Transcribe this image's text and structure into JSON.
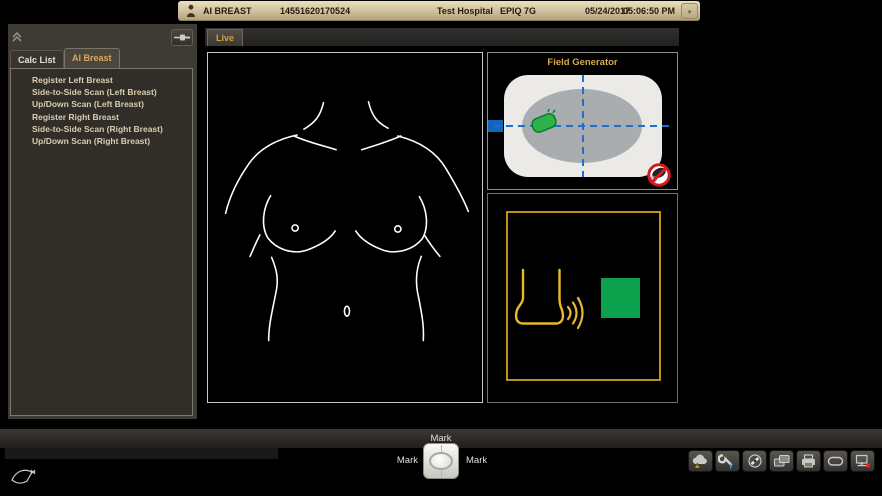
{
  "header": {
    "app_title": "AI BREAST",
    "exam_id": "14551620170524",
    "hospital": "Test Hospital",
    "system": "EPIQ 7G",
    "date": "05/24/2017",
    "time": "05:06:50 PM",
    "dropdown_glyph": "▼"
  },
  "sidebar": {
    "tabs": [
      {
        "label": "Calc List",
        "active": false
      },
      {
        "label": "AI Breast",
        "active": true
      }
    ],
    "items": [
      {
        "label": "Register Left Breast"
      },
      {
        "label": "Side-to-Side Scan (Left Breast)"
      },
      {
        "label": "Up/Down Scan (Left Breast)"
      },
      {
        "label": "Register Right Breast"
      },
      {
        "label": "Side-to-Side Scan (Right Breast)"
      },
      {
        "label": "Up/Down Scan (Right Breast)"
      }
    ]
  },
  "viewport": {
    "live_tab_label": "Live",
    "field_generator_title": "Field Generator"
  },
  "trackball": {
    "top_label": "Mark",
    "left_label": "Mark",
    "right_label": "Mark"
  },
  "toolbar": {
    "icons": [
      "cloud-warning",
      "service-wrench",
      "disc",
      "review-images",
      "print",
      "capsule",
      "workstation-offline"
    ]
  },
  "colors": {
    "accent_gold": "#d9a94f",
    "sensor_green": "#0ca24d",
    "crosshair_blue": "#1e6fd4",
    "alert_red": "#d6191e",
    "header_tan": "#cfc09c"
  }
}
